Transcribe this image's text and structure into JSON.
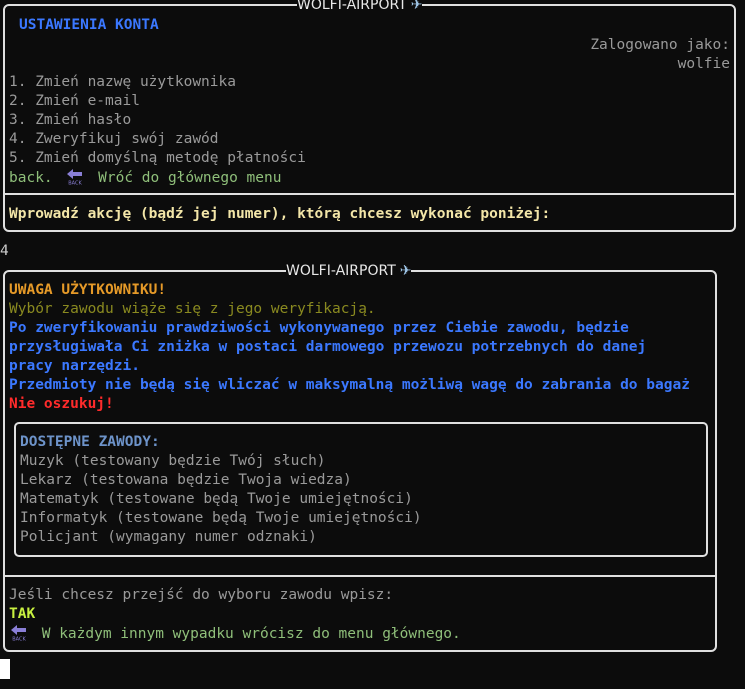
{
  "box1": {
    "title": "WOLFI-AIRPORT",
    "plane_icon": "airplane-icon",
    "heading": "USTAWIENIA KONTA",
    "logged_in_label": "Zalogowano jako:",
    "username": "wolfie",
    "menu_items": [
      "1. Zmień nazwę użytkownika",
      "2. Zmień e-mail",
      "3. Zmień hasło",
      "4. Zweryfikuj swój zawód",
      "5. Zmień domyślną metodę płatności"
    ],
    "back_prefix": "back.",
    "back_icon": "back-arrow-icon",
    "back_label": "Wróć do głównego menu",
    "prompt": "Wprowadź akcję (bądź jej numer), którą chcesz wykonać poniżej:"
  },
  "user_input": "4",
  "box2": {
    "title": "WOLFI-AIRPORT",
    "plane_icon": "airplane-icon",
    "warning_title": "UWAGA UŻYTKOWNIKU!",
    "warning_subtitle": "Wybór zawodu wiąże się z jego weryfikacją.",
    "info_lines": [
      "Po zweryfikowaniu prawdziwości wykonywanego przez Ciebie zawodu, będzie",
      "przysługiwała Ci zniżka w postaci darmowego przewozu potrzebnych do danej",
      "pracy narzędzi.",
      "Przedmioty nie będą się wliczać w maksymalną możliwą wagę do zabrania do bagaż"
    ],
    "no_cheat": "Nie oszukuj!",
    "professions_heading": "DOSTĘPNE ZAWODY:",
    "professions": [
      "Muzyk (testowany będzie Twój słuch)",
      "Lekarz (testowana będzie Twoja wiedza)",
      "Matematyk (testowane będą Twoje umiejętności)",
      "Informatyk (testowane będą Twoje umiejętności)",
      "Policjant (wymagany numer odznaki)"
    ],
    "choose_prompt": "Jeśli chcesz przejść do wyboru zawodu wpisz:",
    "choose_keyword": "TAK",
    "back_icon": "back-arrow-icon",
    "otherwise_text": "W każdym innym wypadku wrócisz do menu głównego."
  },
  "colors": {
    "blue": "#3b78ff",
    "orange": "#e69a28",
    "red": "#ff2b2b",
    "green": "#8fbf7a",
    "lime": "#c8f040"
  }
}
